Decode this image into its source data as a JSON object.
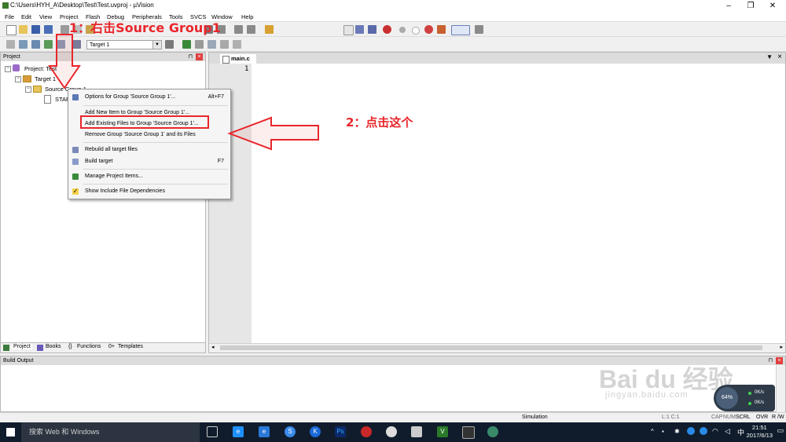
{
  "window": {
    "title": "C:\\Users\\HYH_A\\Desktop\\Test\\Test.uvproj - µVision"
  },
  "menubar": [
    "File",
    "Edit",
    "View",
    "Project",
    "Flash",
    "Debug",
    "Peripherals",
    "Tools",
    "SVCS",
    "Window",
    "Help"
  ],
  "toolbar": {
    "target_select": "Target 1"
  },
  "project_panel": {
    "title": "Project",
    "tree": {
      "root": "Project: Test",
      "target": "Target 1",
      "group": "Source Group 1",
      "file": "STAR"
    },
    "tabs": [
      "Project",
      "Books",
      "Functions",
      "Templates"
    ]
  },
  "editor": {
    "tab": "main.c",
    "line_number": "1"
  },
  "context_menu": {
    "items": [
      {
        "label": "Options for Group 'Source Group 1'...",
        "shortcut": "Alt+F7"
      },
      {
        "label": "Add New  Item to Group 'Source Group 1'...",
        "shortcut": ""
      },
      {
        "label": "Add Existing Files to Group 'Source Group 1'...",
        "shortcut": ""
      },
      {
        "label": "Remove Group 'Source Group 1' and its Files",
        "shortcut": ""
      },
      {
        "label": "Rebuild all target files",
        "shortcut": ""
      },
      {
        "label": "Build target",
        "shortcut": "F7"
      },
      {
        "label": "Manage Project Items...",
        "shortcut": ""
      },
      {
        "label": "Show Include File Dependencies",
        "shortcut": ""
      }
    ],
    "highlighted_index": 2
  },
  "build_output": {
    "title": "Build Output"
  },
  "statusbar": {
    "mode": "Simulation",
    "position": "L:1 C:1",
    "flags": [
      "CAP",
      "NUM",
      "SCRL",
      "OVR",
      "R /W"
    ]
  },
  "annotations": {
    "step1": "1：右击Source Group1",
    "step2": "2：点击这个",
    "color": "#e8262b"
  },
  "taskbar": {
    "search_placeholder": "搜索 Web 和 Windows",
    "time": "21:51",
    "date": "2017/6/13",
    "ime": "中",
    "net_up": "0K/s",
    "net_down": "0K/s",
    "net_percent": "64%"
  },
  "watermark": {
    "brand": "Bai du 经验",
    "url": "jingyan.baidu.com"
  }
}
